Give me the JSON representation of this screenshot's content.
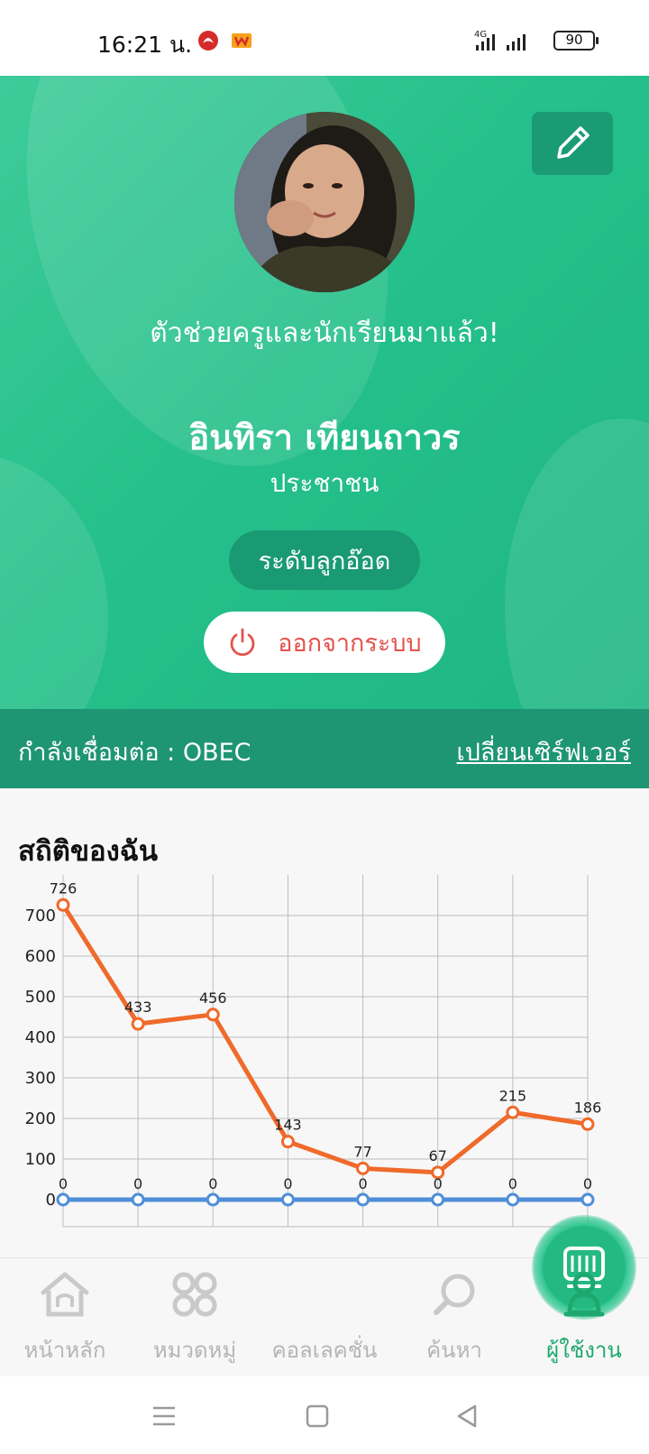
{
  "status_bar": {
    "time": "16:21 น.",
    "network": "4G",
    "battery": "90"
  },
  "profile": {
    "tagline": "ตัวช่วยครูและนักเรียนมาแล้ว!",
    "name": "อินทิรา เทียนถาวร",
    "role": "ประชาชน",
    "level": "ระดับลูกอ๊อด",
    "logout_label": "ออกจากระบบ",
    "server_label": "กำลังเชื่อมต่อ :  OBEC",
    "switch_server_label": "เปลี่ยนเซิร์ฟเวอร์"
  },
  "stats": {
    "title": "สถิติของฉัน"
  },
  "chart_data": {
    "type": "line",
    "x": [
      1,
      2,
      3,
      4,
      5,
      6,
      7,
      8
    ],
    "ylim": [
      0,
      750
    ],
    "yticks": [
      0,
      100,
      200,
      300,
      400,
      500,
      600,
      700
    ],
    "grid": true,
    "series": [
      {
        "values": [
          726,
          433,
          456,
          143,
          77,
          67,
          215,
          186
        ],
        "color": "#ef6a2b"
      },
      {
        "values": [
          0,
          0,
          0,
          0,
          0,
          0,
          0,
          0
        ],
        "color": "#4f8ed8"
      }
    ]
  },
  "bottom_nav": {
    "items": [
      {
        "label": "หน้าหลัก",
        "icon": "home-icon",
        "active": false
      },
      {
        "label": "หมวดหมู่",
        "icon": "category-grid-icon",
        "active": false
      },
      {
        "label": "คอลเลคชั่น",
        "icon": "collection-icon",
        "active": false
      },
      {
        "label": "ค้นหา",
        "icon": "search-icon",
        "active": false
      },
      {
        "label": "ผู้ใช้งาน",
        "icon": "user-icon",
        "active": true
      }
    ]
  },
  "colors": {
    "brand_green": "#25c08b",
    "dark_green": "#1e9573",
    "line_orange": "#ef6a2b",
    "line_blue": "#4f8ed8",
    "logout_red": "#e4534c"
  }
}
